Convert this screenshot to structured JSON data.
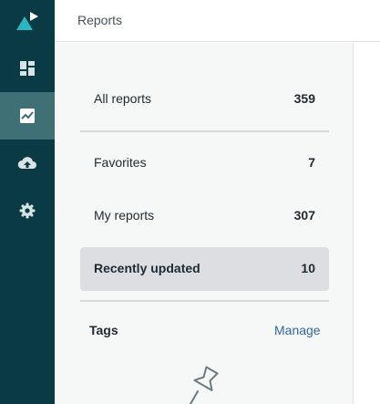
{
  "header": {
    "title": "Reports"
  },
  "sidebar": {
    "items": [
      {
        "name": "dashboard-icon"
      },
      {
        "name": "reports-chart-icon",
        "active": true
      },
      {
        "name": "cloud-upload-icon"
      },
      {
        "name": "gear-icon"
      }
    ]
  },
  "reports": {
    "all": {
      "label": "All reports",
      "count": "359"
    },
    "favorites": {
      "label": "Favorites",
      "count": "7"
    },
    "mine": {
      "label": "My reports",
      "count": "307"
    },
    "recent": {
      "label": "Recently updated",
      "count": "10"
    }
  },
  "tags": {
    "title": "Tags",
    "manage_label": "Manage"
  },
  "colors": {
    "rail": "#0a3a44",
    "rail_active": "#3e7075",
    "logo_accent": "#2bb6c4",
    "link": "#2f6aa3"
  }
}
